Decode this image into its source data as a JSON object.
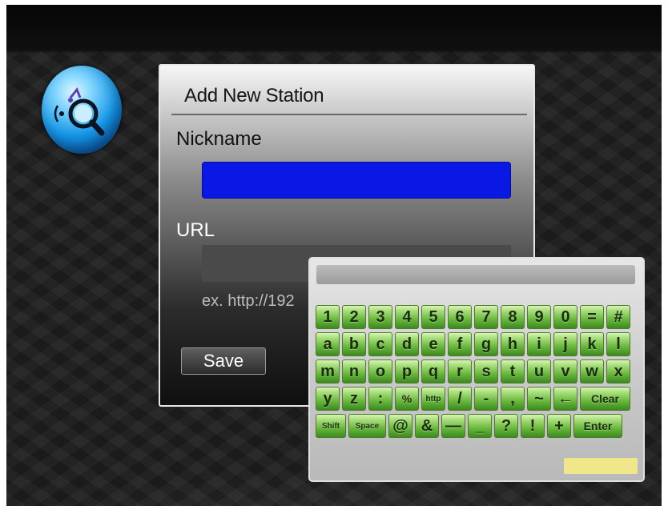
{
  "dialog": {
    "title": "Add New Station",
    "nickname_label": "Nickname",
    "nickname_value": "",
    "url_label": "URL",
    "url_value": "",
    "url_example": "ex. http://192",
    "save_label": "Save"
  },
  "icons": {
    "app_logo": "internet-radio-search-icon"
  },
  "keyboard": {
    "display_value": "",
    "rows": [
      [
        "1",
        "2",
        "3",
        "4",
        "5",
        "6",
        "7",
        "8",
        "9",
        "0",
        "=",
        "#"
      ],
      [
        "a",
        "b",
        "c",
        "d",
        "e",
        "f",
        "g",
        "h",
        "i",
        "j",
        "k",
        "l"
      ],
      [
        "m",
        "n",
        "o",
        "p",
        "q",
        "r",
        "s",
        "t",
        "u",
        "v",
        "w",
        "x"
      ],
      [
        "y",
        "z",
        ":",
        "%",
        "http",
        "/",
        "-",
        ",",
        "~",
        "←",
        "Clear"
      ],
      [
        "Shift",
        "Space",
        "@",
        "&",
        "—",
        "_",
        "?",
        "!",
        "+",
        "Enter"
      ]
    ]
  },
  "colors": {
    "nickname_field": "#0a18e6",
    "key_green": "#66b63a",
    "focus_highlight": "#f0e68a"
  }
}
